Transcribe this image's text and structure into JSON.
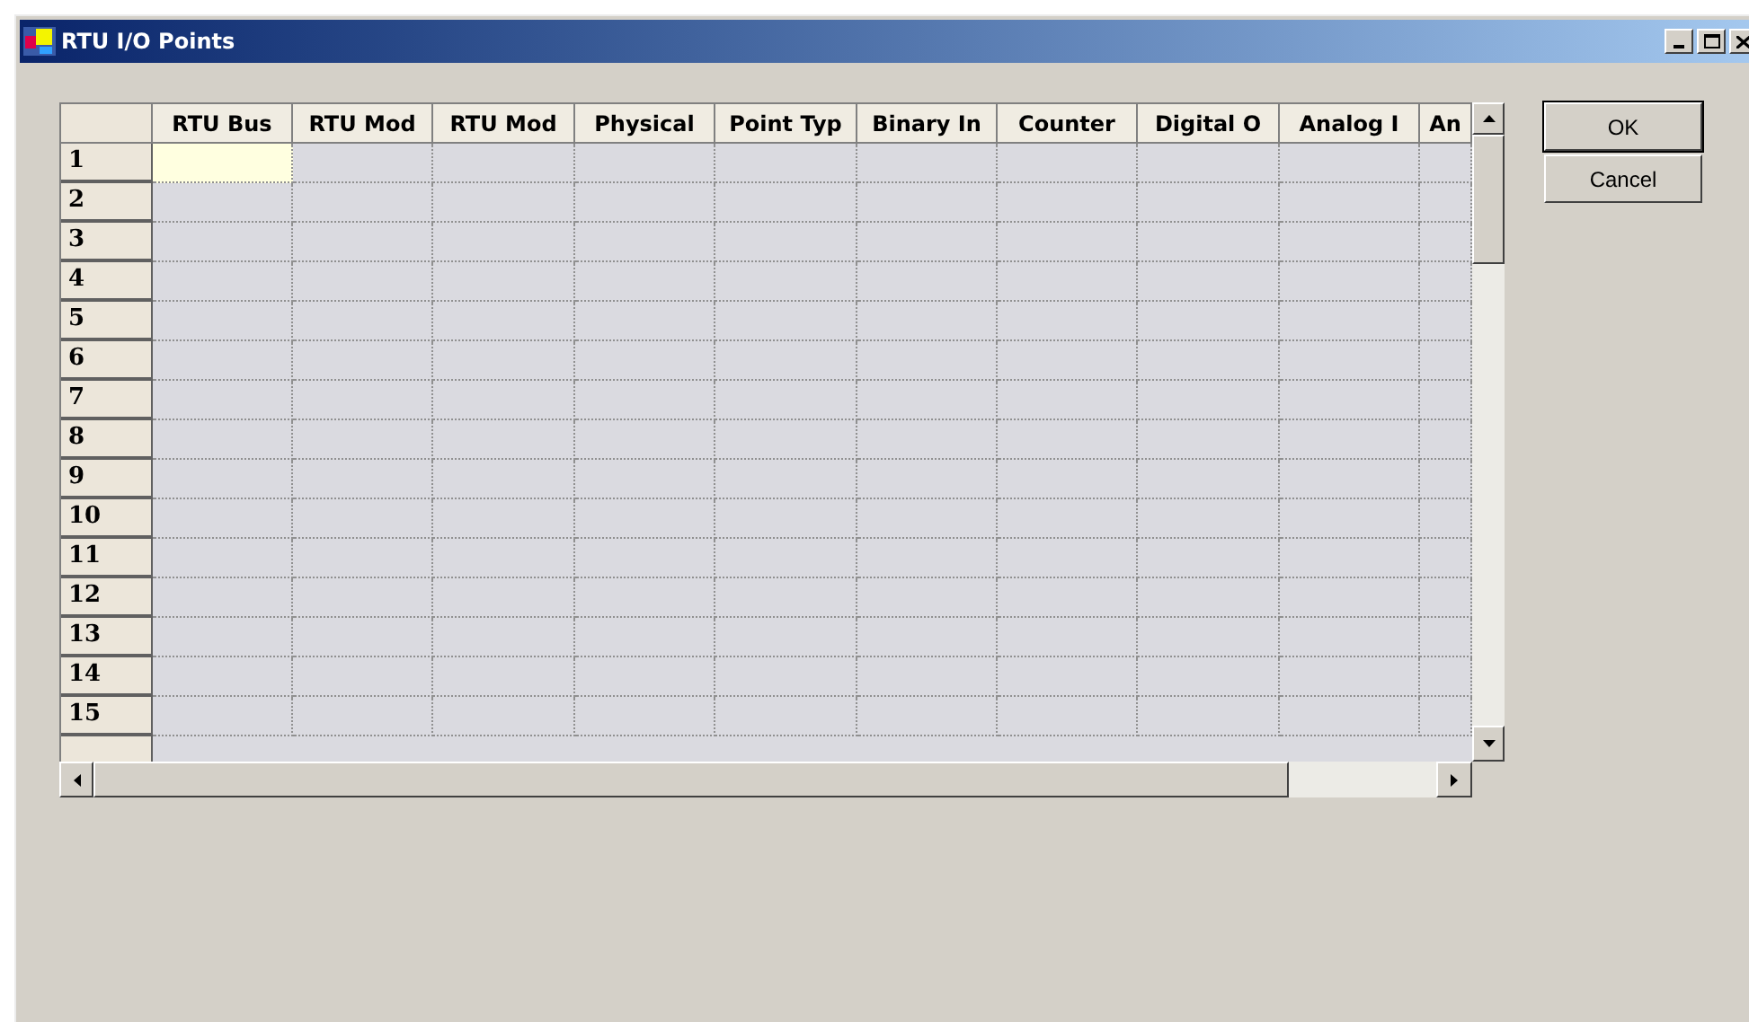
{
  "window": {
    "title": "RTU I/O Points"
  },
  "table": {
    "columns": [
      "RTU Bus",
      "RTU Mod",
      "RTU Mod",
      "Physical",
      "Point Typ",
      "Binary In",
      "Counter",
      "Digital O",
      "Analog I",
      "An"
    ],
    "rows": [
      {
        "label": "1",
        "active": true
      },
      {
        "label": "2",
        "active": false
      },
      {
        "label": "3",
        "active": false
      },
      {
        "label": "4",
        "active": false
      },
      {
        "label": "5",
        "active": false
      },
      {
        "label": "6",
        "active": false
      },
      {
        "label": "7",
        "active": false
      },
      {
        "label": "8",
        "active": false
      },
      {
        "label": "9",
        "active": false
      },
      {
        "label": "10",
        "active": false
      },
      {
        "label": "11",
        "active": false
      },
      {
        "label": "12",
        "active": false
      },
      {
        "label": "13",
        "active": false
      },
      {
        "label": "14",
        "active": false
      },
      {
        "label": "15",
        "active": false
      }
    ]
  },
  "buttons": [
    "OK",
    "Cancel"
  ]
}
